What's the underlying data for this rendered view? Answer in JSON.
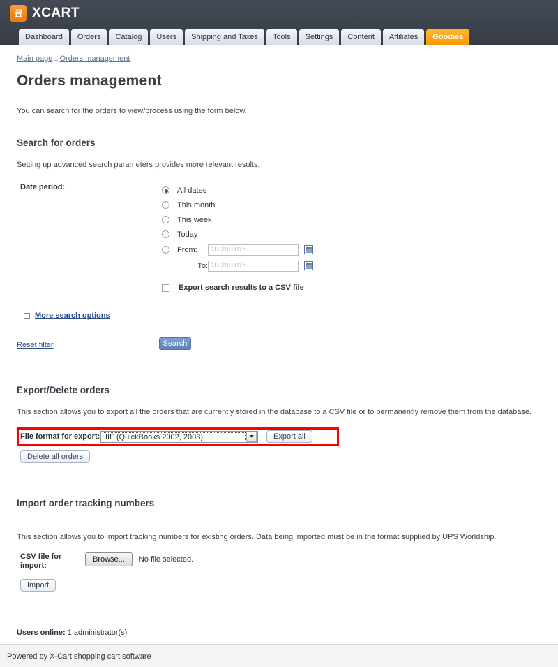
{
  "brand": {
    "name": "XCART",
    "logo_icon": "shopping-cart-icon",
    "accent_color": "#f58220"
  },
  "nav": {
    "tabs": [
      {
        "label": "Dashboard",
        "active": false
      },
      {
        "label": "Orders",
        "active": false
      },
      {
        "label": "Catalog",
        "active": false
      },
      {
        "label": "Users",
        "active": false
      },
      {
        "label": "Shipping and Taxes",
        "active": false
      },
      {
        "label": "Tools",
        "active": false
      },
      {
        "label": "Settings",
        "active": false
      },
      {
        "label": "Content",
        "active": false
      },
      {
        "label": "Affiliates",
        "active": false
      },
      {
        "label": "Goodies",
        "active": true
      }
    ]
  },
  "breadcrumb": {
    "home": "Main page",
    "separator": "::",
    "current": "Orders management"
  },
  "page": {
    "title": "Orders management",
    "intro": "You can search for the orders to view/process using the form below."
  },
  "search_section": {
    "heading": "Search for orders",
    "note": "Setting up advanced search parameters provides more relevant results.",
    "date_period_label": "Date period:",
    "options": [
      {
        "label": "All dates",
        "selected": true
      },
      {
        "label": "This month",
        "selected": false
      },
      {
        "label": "This week",
        "selected": false
      },
      {
        "label": "Today",
        "selected": false
      },
      {
        "label": "From:",
        "selected": false
      }
    ],
    "from_label": "From:",
    "to_label": "To:",
    "from_placeholder": "10-20-2015",
    "to_placeholder": "10-20-2015",
    "calendar_icon": "calendar-icon",
    "export_csv_checkbox": {
      "label": "Export search results to a CSV file",
      "checked": false
    },
    "more_options_label": "More search options",
    "more_options_icon": "plus-box-icon",
    "reset_filter_label": "Reset filter",
    "search_button_label": "Search"
  },
  "export_section": {
    "heading": "Export/Delete orders",
    "note": "This section allows you to export all the orders that are currently stored in the database to a CSV file or to permanently remove them from the database.",
    "format_label": "File format for export:",
    "format_selected": "IIF (QuickBooks 2002, 2003)",
    "export_button_label": "Export all",
    "delete_button_label": "Delete all orders",
    "highlight_color": "#fe0000"
  },
  "import_section": {
    "heading": "Import order tracking numbers",
    "note": "This section allows you to import tracking numbers for existing orders. Data being imported must be in the format supplied by UPS Worldship.",
    "file_label": "CSV file for import:",
    "browse_button_label": "Browse...",
    "file_status": "No file selected.",
    "import_button_label": "Import"
  },
  "footer": {
    "users_online_label": "Users online:",
    "users_online_value": "1 administrator(s)",
    "powered_by": "Powered by X-Cart shopping cart software"
  }
}
